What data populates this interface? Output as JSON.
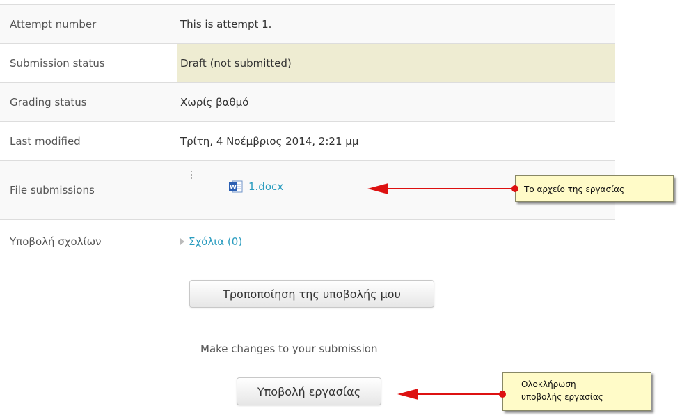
{
  "status_rows": [
    {
      "label": "Attempt number",
      "value": "This is attempt 1."
    },
    {
      "label": "Submission status",
      "value": "Draft (not submitted)"
    },
    {
      "label": "Grading status",
      "value": "Χωρίς βαθμό"
    },
    {
      "label": "Last modified",
      "value": "Τρίτη, 4 Νοέμβριος 2014, 2:21 μμ"
    }
  ],
  "file_submissions": {
    "label": "File submissions",
    "file_name": "1.docx",
    "file_icon": "word-document-icon"
  },
  "comments": {
    "label": "Υποβολή σχολίων",
    "link_text": "Σχόλια (0)",
    "toggle_icon": "triangle-right-icon"
  },
  "actions": {
    "edit_button": "Τροποποίηση της υποβολής μου",
    "edit_description": "Make changes to your submission",
    "submit_button": "Υποβολή εργασίας"
  },
  "annotations": {
    "file_note": "Το αρχείο της εργασίας",
    "submit_note_line1": "Ολοκλήρωση",
    "submit_note_line2": "υποβολής εργασίας"
  },
  "colors": {
    "link": "#2a9cbf",
    "draft_highlight": "#eeecd2",
    "callout_bg": "#fffbc8",
    "arrow": "#dd1111"
  }
}
